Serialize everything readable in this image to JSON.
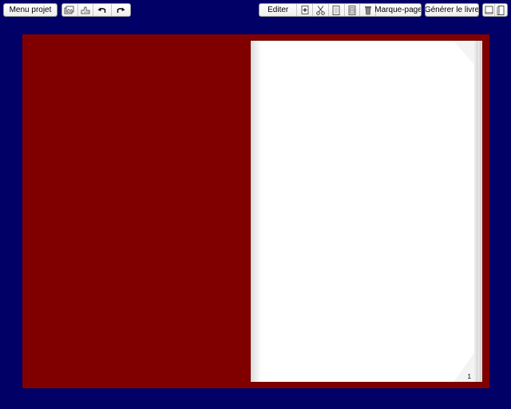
{
  "toolbar": {
    "menu_projet": "Menu projet",
    "editer": "Editer",
    "marque_page": "Marque-page",
    "generer_livre": "Générer le livre",
    "icons": {
      "import1": "import-photos-icon",
      "import2": "import-hand-icon",
      "undo": "undo-icon",
      "redo": "redo-icon",
      "add_page": "add-page-icon",
      "cut": "scissors-icon",
      "copy": "copy-page-icon",
      "paste": "paste-page-icon",
      "delete": "trash-icon",
      "single_view": "single-page-view-icon",
      "double_view": "double-page-view-icon"
    }
  },
  "book": {
    "cover_color": "#800000",
    "page_number": "1"
  },
  "colors": {
    "background": "#000066",
    "cover": "#800000",
    "page": "#ffffff"
  }
}
